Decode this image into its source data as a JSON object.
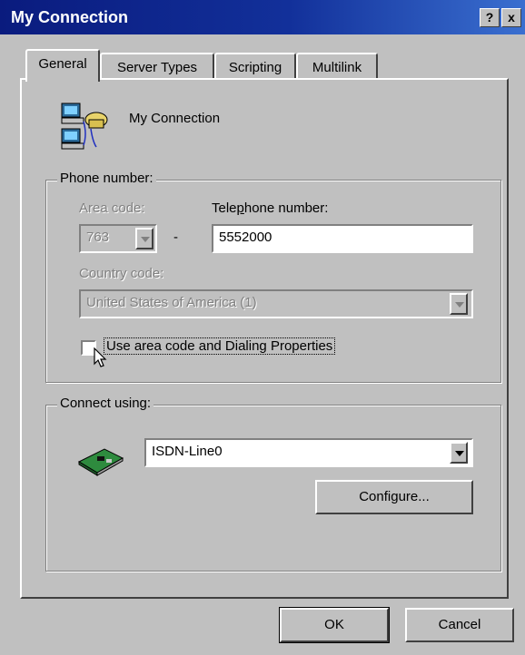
{
  "window": {
    "title": "My Connection",
    "help_label": "?",
    "close_label": "x"
  },
  "tabs": [
    {
      "label": "General",
      "active": true
    },
    {
      "label": "Server Types",
      "active": false
    },
    {
      "label": "Scripting",
      "active": false
    },
    {
      "label": "Multilink",
      "active": false
    }
  ],
  "connection": {
    "name": "My Connection",
    "icon": "network-computers-icon"
  },
  "phone_number": {
    "group_label": "Phone number:",
    "area_code_label": "Area code:",
    "area_code_value": "763",
    "dash": "-",
    "telephone_label": "Telephone number:",
    "telephone_value": "5552000",
    "country_code_label": "Country code:",
    "country_code_value": "United States of America (1)",
    "use_dialing_label": "Use area code and Dialing Properties",
    "use_dialing_checked": false
  },
  "connect_using": {
    "group_label": "Connect using:",
    "device_value": "ISDN-Line0",
    "device_icon": "modem-card-icon",
    "configure_label": "Configure..."
  },
  "footer": {
    "ok_label": "OK",
    "cancel_label": "Cancel"
  }
}
